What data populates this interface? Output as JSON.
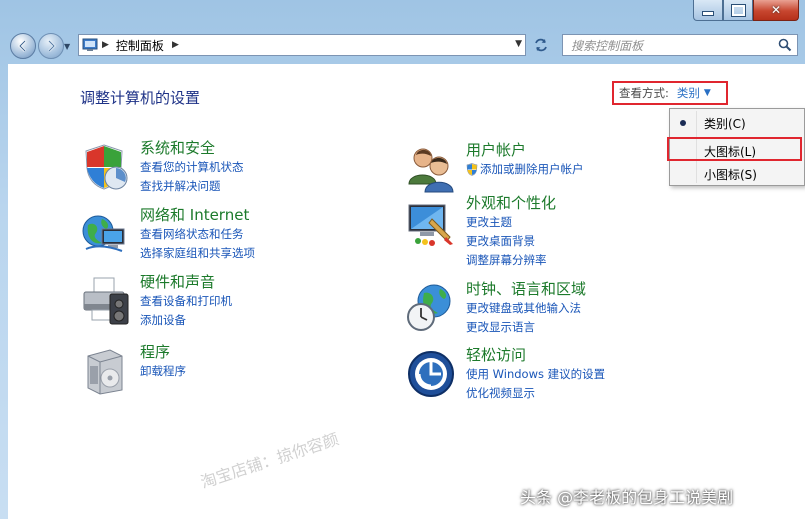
{
  "window": {
    "controls": {
      "minimize": "minimize",
      "maximize": "maximize",
      "close": "✕"
    }
  },
  "nav": {
    "breadcrumb": "控制面板",
    "search_placeholder": "搜索控制面板"
  },
  "page": {
    "title": "调整计算机的设置",
    "view_by": {
      "label": "查看方式:",
      "value": "类别"
    }
  },
  "view_menu": {
    "items": [
      {
        "label": "类别(C)",
        "selected": true
      },
      {
        "label": "大图标(L)",
        "highlighted": true
      },
      {
        "label": "小图标(S)"
      }
    ]
  },
  "categories": [
    {
      "title": "系统和安全",
      "icon": "shield-icon",
      "links": [
        "查看您的计算机状态",
        "查找并解决问题"
      ]
    },
    {
      "title": "网络和 Internet",
      "icon": "network-globe-icon",
      "links": [
        "查看网络状态和任务",
        "选择家庭组和共享选项"
      ]
    },
    {
      "title": "硬件和声音",
      "icon": "printer-icon",
      "links": [
        "查看设备和打印机",
        "添加设备"
      ]
    },
    {
      "title": "程序",
      "icon": "programs-box-icon",
      "links": [
        "卸载程序"
      ]
    },
    {
      "title": "用户帐户",
      "icon": "users-icon",
      "links": [
        "添加或删除用户帐户"
      ]
    },
    {
      "title": "外观和个性化",
      "icon": "appearance-monitor-icon",
      "links": [
        "更改主题",
        "更改桌面背景",
        "调整屏幕分辨率"
      ]
    },
    {
      "title": "时钟、语言和区域",
      "icon": "clock-globe-icon",
      "links": [
        "更改键盘或其他输入法",
        "更改显示语言"
      ]
    },
    {
      "title": "轻松访问",
      "icon": "ease-of-access-icon",
      "links": [
        "使用 Windows 建议的设置",
        "优化视频显示"
      ]
    }
  ],
  "watermarks": [
    "淘宝店铺：掠你容颜",
    "头条 @李老板的包身工说美剧"
  ]
}
